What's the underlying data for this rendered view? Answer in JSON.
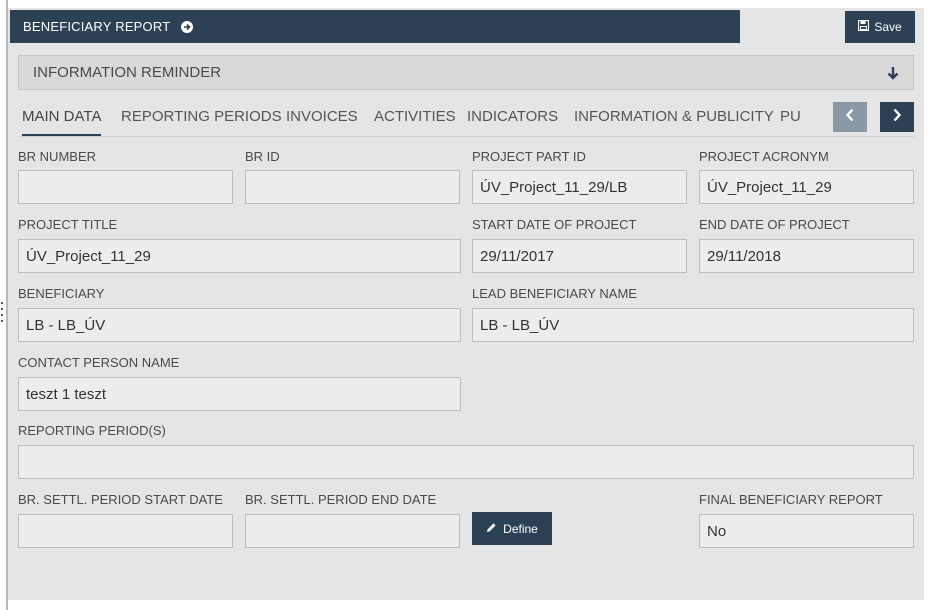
{
  "header": {
    "title": "BENEFICIARY REPORT",
    "save_label": "Save"
  },
  "info_reminder": {
    "label": "INFORMATION REMINDER"
  },
  "tabs": [
    {
      "label": "MAIN DATA"
    },
    {
      "label": "REPORTING PERIODS"
    },
    {
      "label": "INVOICES"
    },
    {
      "label": "ACTIVITIES"
    },
    {
      "label": "INDICATORS"
    },
    {
      "label": "INFORMATION & PUBLICITY"
    },
    {
      "label": "PU"
    }
  ],
  "fields": {
    "br_number": {
      "label": "BR NUMBER",
      "value": ""
    },
    "br_id": {
      "label": "BR ID",
      "value": ""
    },
    "project_part_id": {
      "label": "PROJECT PART ID",
      "value": "ÚV_Project_11_29/LB"
    },
    "project_acronym": {
      "label": "PROJECT ACRONYM",
      "value": "ÚV_Project_11_29"
    },
    "project_title": {
      "label": "PROJECT TITLE",
      "value": "ÚV_Project_11_29"
    },
    "start_date": {
      "label": "START DATE OF PROJECT",
      "value": "29/11/2017"
    },
    "end_date": {
      "label": "END DATE OF PROJECT",
      "value": "29/11/2018"
    },
    "beneficiary": {
      "label": "BENEFICIARY",
      "value": "LB - LB_ÚV"
    },
    "lead_beneficiary": {
      "label": "LEAD BENEFICIARY NAME",
      "value": "LB - LB_ÚV"
    },
    "contact_person": {
      "label": "CONTACT PERSON NAME",
      "value": "teszt 1 teszt"
    },
    "reporting_periods": {
      "label": "REPORTING PERIOD(S)",
      "value": ""
    },
    "settl_start": {
      "label": "BR. SETTL. PERIOD START DATE",
      "value": ""
    },
    "settl_end": {
      "label": "BR. SETTL. PERIOD END DATE",
      "value": ""
    },
    "final_report": {
      "label": "FINAL BENEFICIARY REPORT",
      "value": "No"
    }
  },
  "define_button": {
    "label": "Define"
  },
  "icons": {
    "header": "arrow-circle-right-icon",
    "save": "floppy-disk-icon",
    "reminder": "arrow-down-icon",
    "define": "pencil-icon",
    "tab_prev": "chevron-left-icon",
    "tab_next": "chevron-right-icon"
  },
  "colors": {
    "primary": "#2d4155",
    "disabled_nav": "#8b99a6",
    "panel": "#e5e5e5"
  }
}
